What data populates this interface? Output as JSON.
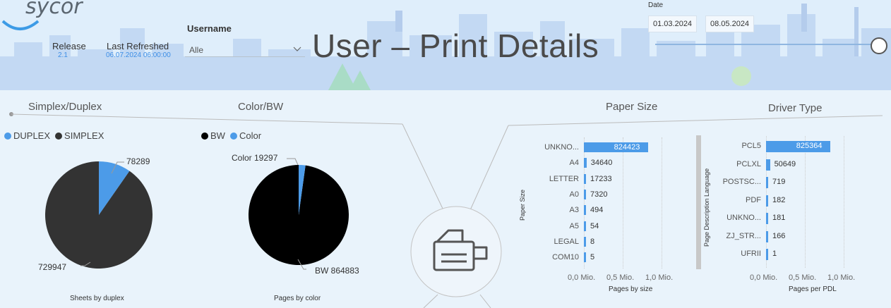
{
  "header": {
    "logo": "sycor",
    "release_label": "Release",
    "release_value": "2.1",
    "refreshed_label": "Last Refreshed",
    "refreshed_value": "06.07.2024 06:00:00",
    "username_label": "Username",
    "username_value": "Alle",
    "title": "User – Print Details",
    "date_label": "Date",
    "date_from": "01.03.2024",
    "date_to": "08.05.2024"
  },
  "colors": {
    "blue": "#4c9be8",
    "dark": "#333333",
    "black": "#000000"
  },
  "chart_data": [
    {
      "type": "pie",
      "title": "Simplex/Duplex",
      "caption": "Sheets by duplex",
      "legend": [
        "DUPLEX",
        "SIMPLEX"
      ],
      "slices": [
        {
          "name": "DUPLEX",
          "value": 78289,
          "label": "78289"
        },
        {
          "name": "SIMPLEX",
          "value": 729947,
          "label": "729947"
        }
      ]
    },
    {
      "type": "pie",
      "title": "Color/BW",
      "caption": "Pages by color",
      "legend": [
        "BW",
        "Color"
      ],
      "slices": [
        {
          "name": "BW",
          "value": 864883,
          "label": "BW 864883"
        },
        {
          "name": "Color",
          "value": 19297,
          "label": "Color 19297"
        }
      ]
    },
    {
      "type": "bar",
      "title": "Paper Size",
      "xlabel": "Pages by size",
      "ylabel": "Paper Size",
      "categories": [
        "UNKNO...",
        "A4",
        "LETTER",
        "A0",
        "A3",
        "A5",
        "LEGAL",
        "COM10"
      ],
      "values": [
        824423,
        34640,
        17233,
        7320,
        494,
        54,
        8,
        5
      ],
      "xticks": [
        "0,0 Mio.",
        "0,5 Mio.",
        "1,0 Mio."
      ],
      "xlim": [
        0,
        1000000
      ]
    },
    {
      "type": "bar",
      "title": "Driver Type",
      "xlabel": "Pages per PDL",
      "ylabel": "Page Description Language",
      "categories": [
        "PCL5",
        "PCLXL",
        "POSTSC...",
        "PDF",
        "UNKNO...",
        "ZJ_STR...",
        "UFRII"
      ],
      "values": [
        825364,
        50649,
        719,
        182,
        181,
        166,
        1
      ],
      "xticks": [
        "0,0 Mio.",
        "0,5 Mio.",
        "1,0 Mio."
      ],
      "xlim": [
        0,
        1000000
      ]
    }
  ]
}
